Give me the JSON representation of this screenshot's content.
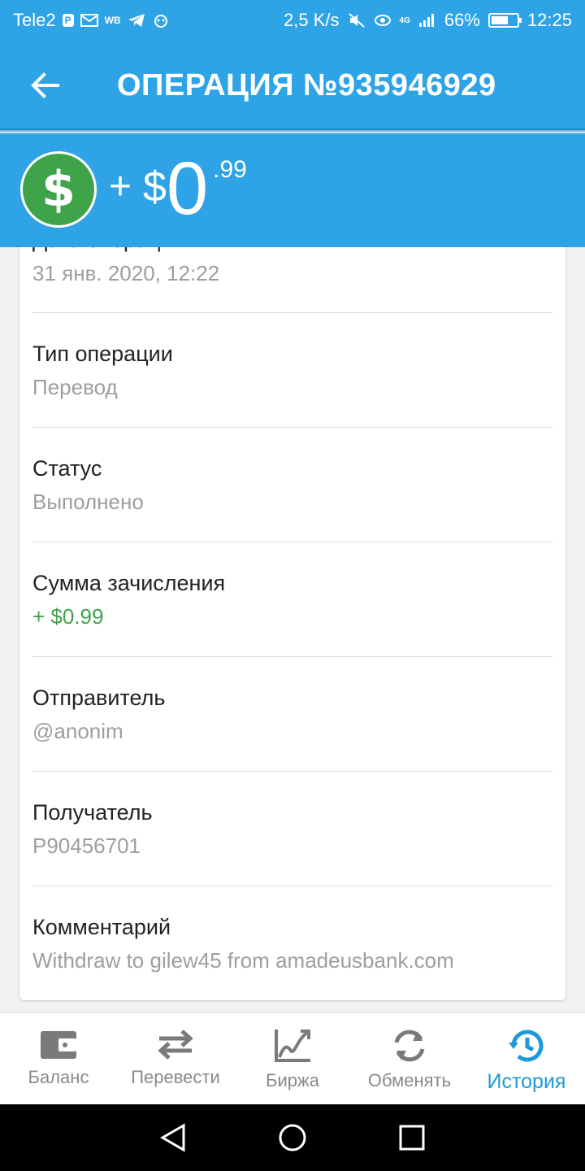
{
  "status_bar": {
    "carrier": "Tele2",
    "p_badge": "P",
    "wb_label": "WB",
    "net_speed": "2,5 K/s",
    "network_badge": "4G",
    "battery": "66%",
    "time": "12:25"
  },
  "toolbar": {
    "title": "ОПЕРАЦИЯ №935946929"
  },
  "amount": {
    "sign": "+",
    "currency": "$",
    "whole": "0",
    "cents": ".99"
  },
  "details": [
    {
      "label": "Дата операции",
      "value": "31 янв. 2020, 12:22"
    },
    {
      "label": "Тип операции",
      "value": "Перевод"
    },
    {
      "label": "Статус",
      "value": "Выполнено"
    },
    {
      "label": "Сумма зачисления",
      "value": "+ $0.99"
    },
    {
      "label": "Отправитель",
      "value": "@anonim"
    },
    {
      "label": "Получатель",
      "value": "P90456701"
    },
    {
      "label": "Комментарий",
      "value": "Withdraw to gilew45 from amadeusbank.com"
    }
  ],
  "bottom_nav": [
    {
      "label": "Баланс",
      "icon": "wallet-icon"
    },
    {
      "label": "Перевести",
      "icon": "transfer-arrows-icon"
    },
    {
      "label": "Биржа",
      "icon": "chart-icon"
    },
    {
      "label": "Обменять",
      "icon": "exchange-refresh-icon"
    },
    {
      "label": "История",
      "icon": "history-icon",
      "active": true
    }
  ],
  "colors": {
    "primary": "#2ea3e6",
    "accent_green": "#3fa34a",
    "active_nav": "#1e9ad6"
  }
}
